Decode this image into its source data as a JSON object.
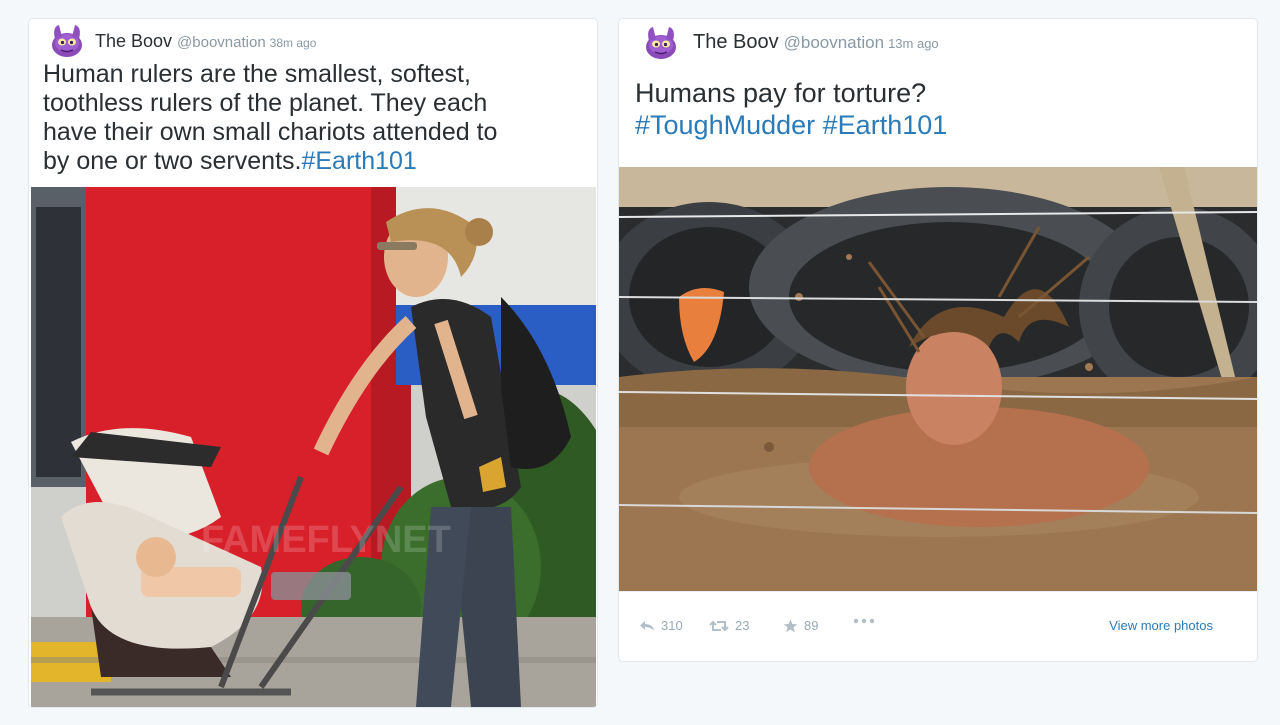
{
  "tweets": [
    {
      "author_name": "The Boov",
      "author_handle": "@boovnation",
      "timestamp": "38m ago",
      "text_lines": [
        "Human rulers are the smallest, softest,",
        "toothless rulers of the planet. They each",
        "have their own small chariots attended to",
        "by one or two servents."
      ],
      "hashtag": "#Earth101",
      "watermark": "FAMEFLYNET"
    },
    {
      "author_name": "The Boov",
      "author_handle": "@boovnation",
      "timestamp": "13m ago",
      "text": "Humans pay for torture?",
      "hashtags": [
        "#ToughMudder",
        "#Earth101"
      ],
      "actions": {
        "reply_count": "310",
        "retweet_count": "23",
        "favorite_count": "89"
      },
      "view_more_label": "View more photos"
    }
  ],
  "colors": {
    "link": "#2b7bb9",
    "muted": "#8899a6",
    "text": "#292f33",
    "background": "#f5f8fa"
  }
}
